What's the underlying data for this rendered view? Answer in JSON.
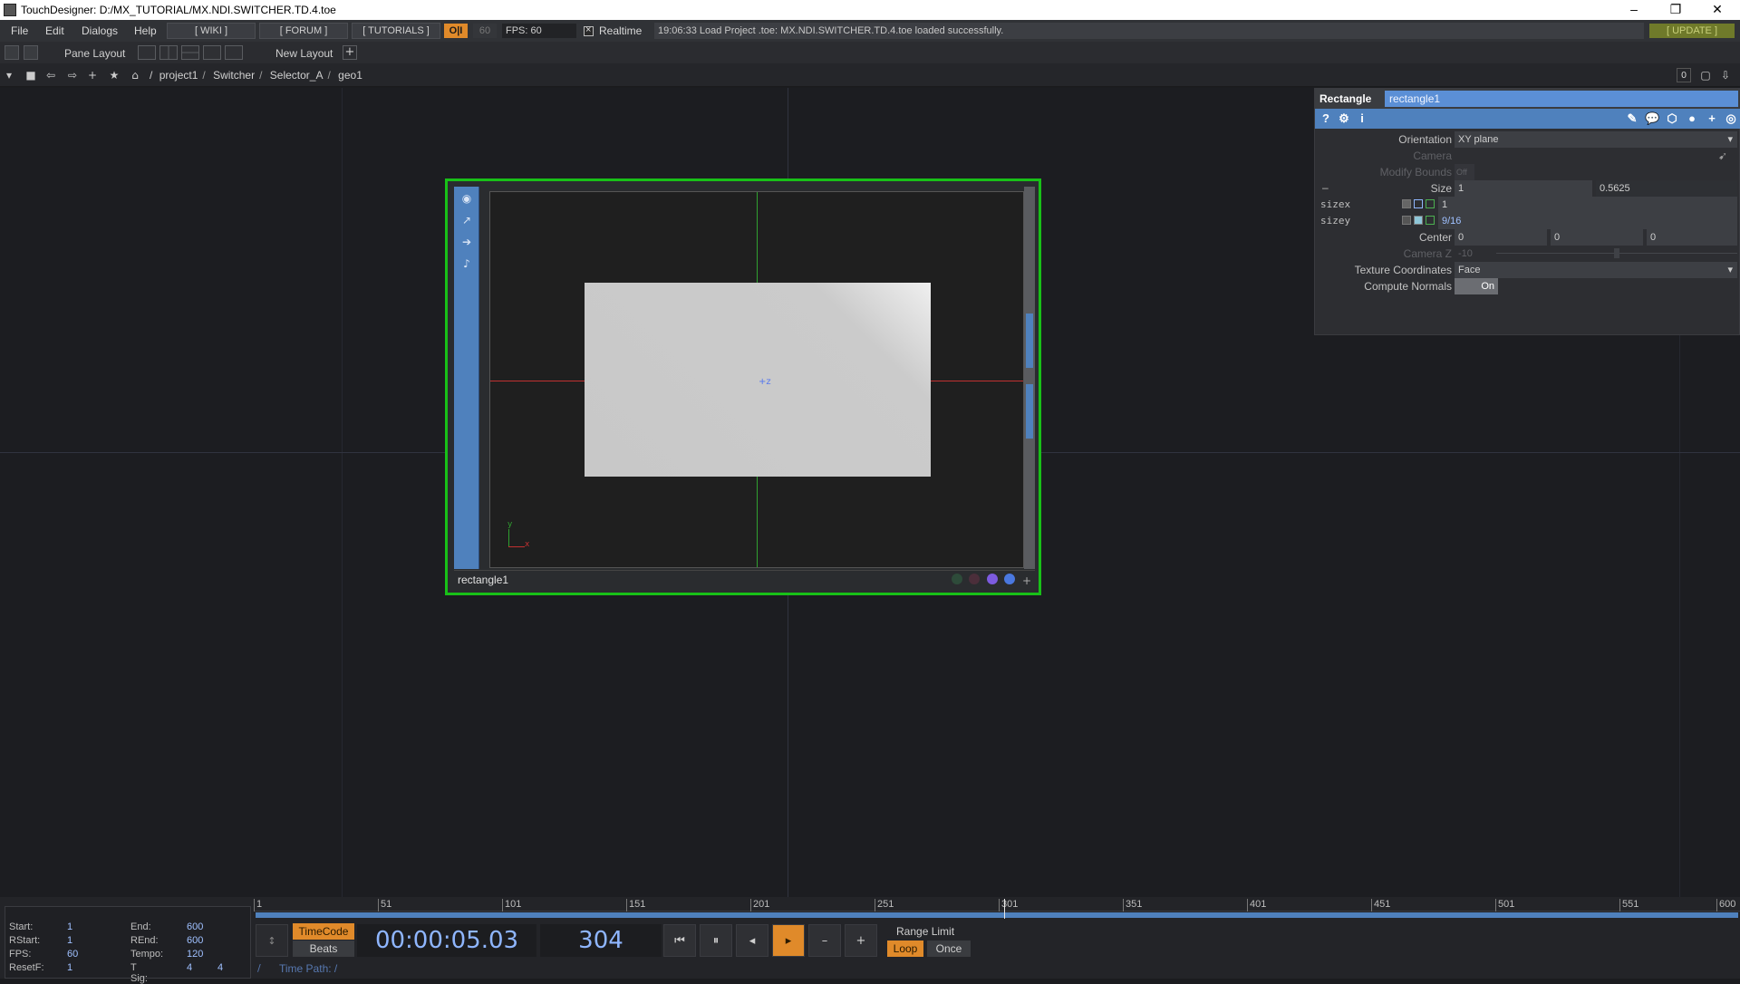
{
  "window": {
    "title": "TouchDesigner: D:/MX_TUTORIAL/MX.NDI.SWITCHER.TD.4.toe",
    "controls": [
      "–",
      "❐",
      "✕"
    ]
  },
  "menubar": {
    "items": [
      "File",
      "Edit",
      "Dialogs",
      "Help"
    ],
    "wiki": "[ WIKI ]",
    "forum": "[ FORUM ]",
    "tutorials": "[ TUTORIALS ]",
    "oii": "O|I",
    "rate_box": "60",
    "fps": "FPS: 60",
    "realtime": "Realtime",
    "status": "19:06:33 Load Project .toe: MX.NDI.SWITCHER.TD.4.toe loaded successfully.",
    "update": "[ UPDATE ]"
  },
  "panebar": {
    "pane_layout": "Pane Layout",
    "new_layout": "New Layout"
  },
  "pathbar": {
    "crumbs": [
      "/",
      "project1",
      "Switcher",
      "Selector_A",
      "geo1"
    ],
    "right_value": "0"
  },
  "node": {
    "name": "rectangle1",
    "viewer_axis": "+z",
    "gizmo_y": "y",
    "gizmo_x": "x",
    "dot_colors": [
      "#2e4b3a",
      "#4b2e3a",
      "#7d5be0",
      "#4a78e0"
    ]
  },
  "params": {
    "op_type": "Rectangle",
    "op_name": "rectangle1",
    "rows": {
      "orientation": {
        "label": "Orientation",
        "value": "XY plane"
      },
      "camera": {
        "label": "Camera"
      },
      "modify_bounds": {
        "label": "Modify Bounds",
        "value": "Off"
      },
      "size": {
        "label": "Size",
        "x": "1",
        "y": "0.5625"
      },
      "sizex": {
        "label": "sizex",
        "value": "1"
      },
      "sizey": {
        "label": "sizey",
        "value": "9/16"
      },
      "center": {
        "label": "Center",
        "x": "0",
        "y": "0",
        "z": "0"
      },
      "camera_z": {
        "label": "Camera Z",
        "value": "-10"
      },
      "texture_coordinates": {
        "label": "Texture Coordinates",
        "value": "Face"
      },
      "compute_normals": {
        "label": "Compute Normals",
        "value": "On"
      }
    }
  },
  "timeline": {
    "stats": {
      "start_k": "Start:",
      "start_v": "1",
      "end_k": "End:",
      "end_v": "600",
      "rstart_k": "RStart:",
      "rstart_v": "1",
      "rend_k": "REnd:",
      "rend_v": "600",
      "fps_k": "FPS:",
      "fps_v": "60",
      "tempo_k": "Tempo:",
      "tempo_v": "120",
      "resetf_k": "ResetF:",
      "resetf_v": "1",
      "tsig_k": "T Sig:",
      "tsig_v1": "4",
      "tsig_v2": "4"
    },
    "ruler_ticks": [
      "1",
      "51",
      "101",
      "151",
      "201",
      "251",
      "301",
      "351",
      "401",
      "451",
      "501",
      "551",
      "600"
    ],
    "timecode_label": "TimeCode",
    "beats_label": "Beats",
    "time": "00:00:05.03",
    "frame": "304",
    "range_limit": "Range Limit",
    "loop": "Loop",
    "once": "Once",
    "time_path": "Time Path: /",
    "side_label": "/"
  }
}
